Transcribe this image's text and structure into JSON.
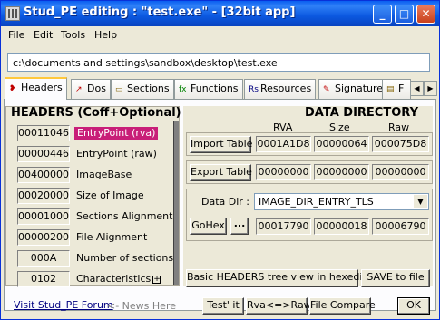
{
  "window": {
    "title": "Stud_PE editing : \"test.exe\" - [32bit app]",
    "controls": {
      "minimize": "_",
      "maximize": "□",
      "close": "✕"
    }
  },
  "menu": [
    "File",
    "Edit",
    "Tools",
    "Help"
  ],
  "path": "c:\\documents and settings\\sandbox\\desktop\\test.exe",
  "tabs": [
    {
      "label": "Headers",
      "icon": "headers-icon",
      "glyph": "❥"
    },
    {
      "label": "Dos",
      "icon": "dos-icon",
      "glyph": "↗"
    },
    {
      "label": "Sections",
      "icon": "sections-icon",
      "glyph": "▭"
    },
    {
      "label": "Functions",
      "icon": "functions-icon",
      "glyph": "fx"
    },
    {
      "label": "Resources",
      "icon": "resources-icon",
      "glyph": "Rs"
    },
    {
      "label": "Signature",
      "icon": "signature-icon",
      "glyph": "✎"
    },
    {
      "label": "F",
      "icon": "file-icon",
      "glyph": "▤"
    }
  ],
  "tab_arrows": {
    "left": "◀",
    "right": "▶"
  },
  "headers": {
    "title": "HEADERS (Coff+Optional)",
    "rows": [
      {
        "value": "00011046",
        "label": "EntryPoint (rva)"
      },
      {
        "value": "00000446",
        "label": "EntryPoint (raw)"
      },
      {
        "value": "00400000",
        "label": "ImageBase"
      },
      {
        "value": "00020000",
        "label": "Size of Image"
      },
      {
        "value": "00001000",
        "label": "Sections Alignment"
      },
      {
        "value": "00000200",
        "label": "File Alignment"
      },
      {
        "value": "000A",
        "label": "Number of sections"
      },
      {
        "value": "0102",
        "label": "Characteristics"
      }
    ],
    "plus": "+"
  },
  "data_directory": {
    "title": "DATA  DIRECTORY",
    "col_rva": "RVA",
    "col_size": "Size",
    "col_raw": "Raw",
    "import": {
      "label": "Import Table",
      "rva": "0001A1D8",
      "size": "00000064",
      "raw": "000075D8"
    },
    "export": {
      "label": "Export Table",
      "rva": "00000000",
      "size": "00000000",
      "raw": "00000000"
    },
    "datadir_label": "Data Dir :",
    "datadir_value": "IMAGE_DIR_ENTRY_TLS",
    "dropdown_arrow": "▼",
    "gohex": "GoHex",
    "dots": "...",
    "entry": {
      "rva": "00017790",
      "size": "00000018",
      "raw": "00006790"
    }
  },
  "buttons": {
    "tree_view": "Basic HEADERS tree view in hexeditor",
    "save": "SAVE to file",
    "test": "Test' it",
    "rva_raw": "Rva<=>Raw",
    "compare": "File Compare",
    "ok": "OK"
  },
  "footer": {
    "forum": "Visit Stud_PE Forum",
    "news": "<- News Here"
  }
}
